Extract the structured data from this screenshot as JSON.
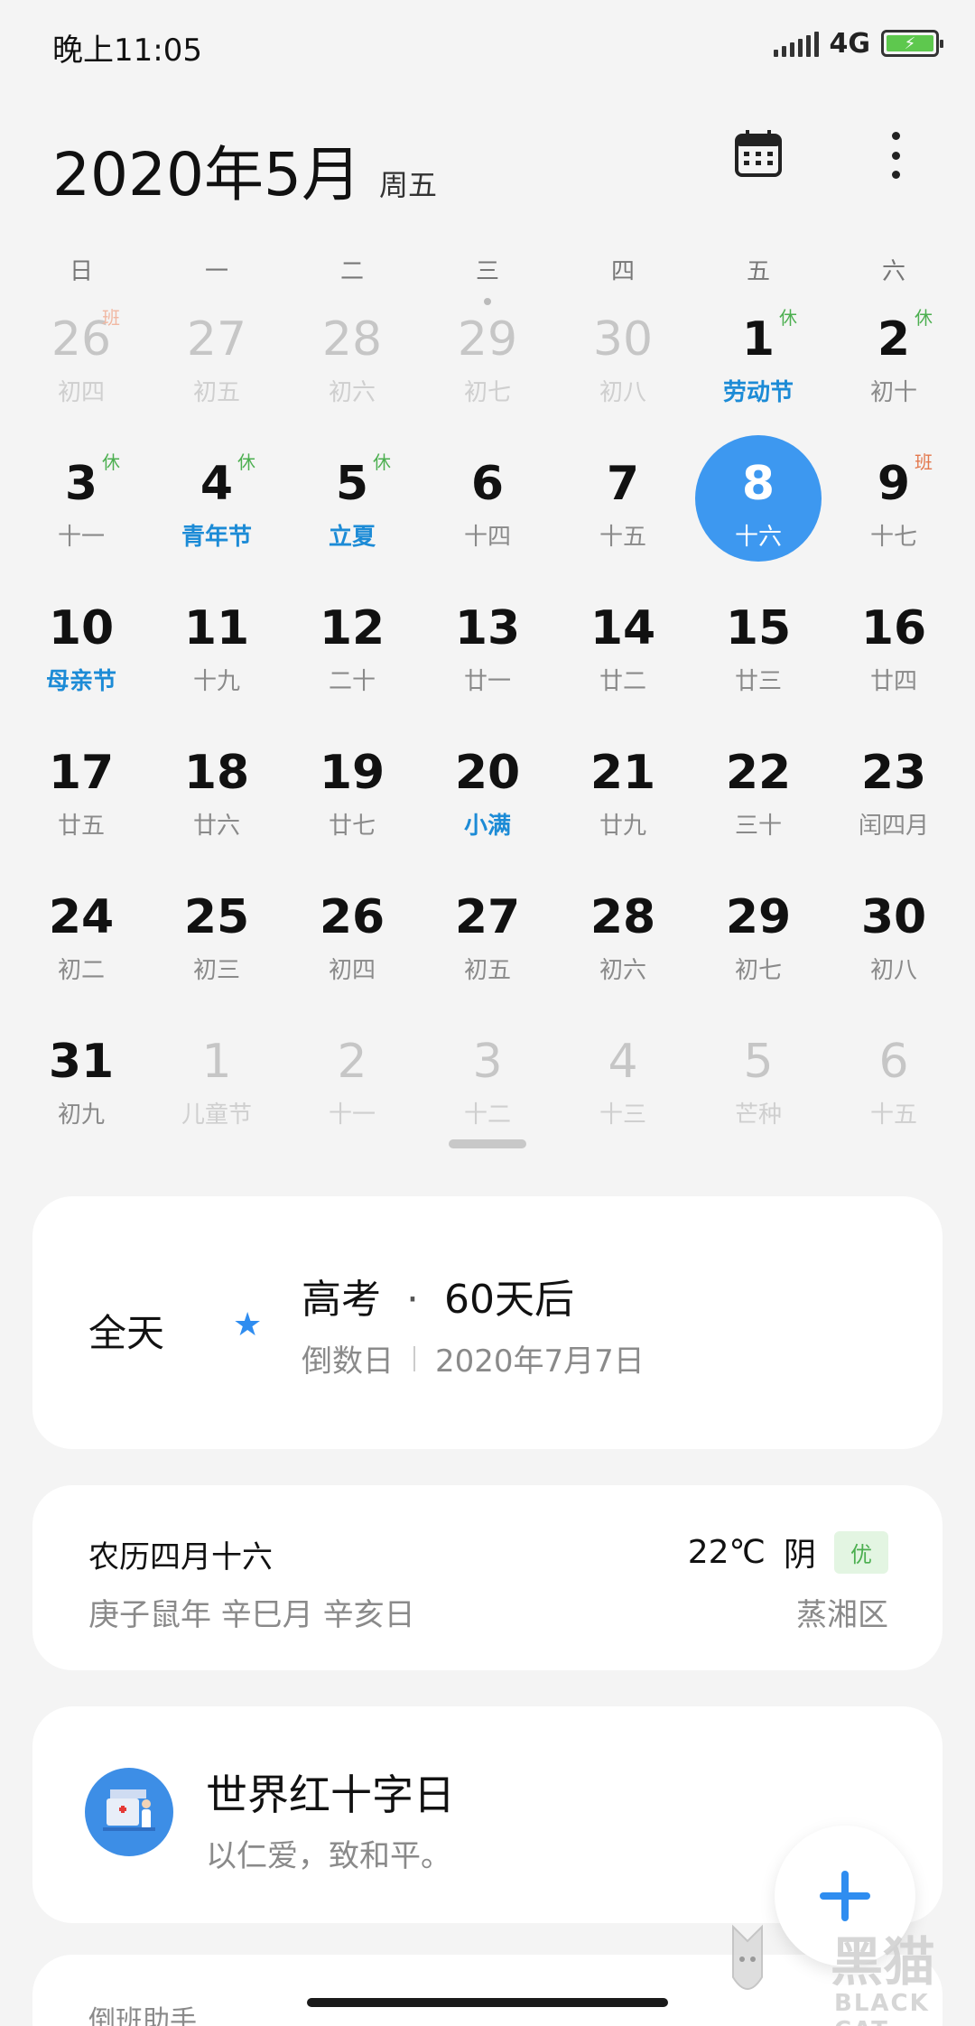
{
  "status_bar": {
    "time": "晚上11:05",
    "network": "4G",
    "battery_level_percent": 100
  },
  "header": {
    "title": "2020年5月",
    "weekday": "周五",
    "calendar_icon": "calendar-icon",
    "more_icon": "more-vertical-icon"
  },
  "weekday_headers": [
    "日",
    "一",
    "二",
    "三",
    "四",
    "五",
    "六"
  ],
  "weeks": [
    [
      {
        "day": "26",
        "lunar": "初四",
        "muted": true,
        "tag": "班",
        "tag_type": "work"
      },
      {
        "day": "27",
        "lunar": "初五",
        "muted": true
      },
      {
        "day": "28",
        "lunar": "初六",
        "muted": true
      },
      {
        "day": "29",
        "lunar": "初七",
        "muted": true,
        "dot": true
      },
      {
        "day": "30",
        "lunar": "初八",
        "muted": true
      },
      {
        "day": "1",
        "lunar": "劳动节",
        "festival": true,
        "tag": "休",
        "tag_type": "rest"
      },
      {
        "day": "2",
        "lunar": "初十",
        "tag": "休",
        "tag_type": "rest"
      }
    ],
    [
      {
        "day": "3",
        "lunar": "十一",
        "tag": "休",
        "tag_type": "rest"
      },
      {
        "day": "4",
        "lunar": "青年节",
        "festival": true,
        "tag": "休",
        "tag_type": "rest"
      },
      {
        "day": "5",
        "lunar": "立夏",
        "festival": true,
        "tag": "休",
        "tag_type": "rest"
      },
      {
        "day": "6",
        "lunar": "十四"
      },
      {
        "day": "7",
        "lunar": "十五"
      },
      {
        "day": "8",
        "lunar": "十六",
        "today": true
      },
      {
        "day": "9",
        "lunar": "十七",
        "tag": "班",
        "tag_type": "work"
      }
    ],
    [
      {
        "day": "10",
        "lunar": "母亲节",
        "festival": true
      },
      {
        "day": "11",
        "lunar": "十九"
      },
      {
        "day": "12",
        "lunar": "二十"
      },
      {
        "day": "13",
        "lunar": "廿一"
      },
      {
        "day": "14",
        "lunar": "廿二"
      },
      {
        "day": "15",
        "lunar": "廿三"
      },
      {
        "day": "16",
        "lunar": "廿四"
      }
    ],
    [
      {
        "day": "17",
        "lunar": "廿五"
      },
      {
        "day": "18",
        "lunar": "廿六"
      },
      {
        "day": "19",
        "lunar": "廿七"
      },
      {
        "day": "20",
        "lunar": "小满",
        "festival": true
      },
      {
        "day": "21",
        "lunar": "廿九"
      },
      {
        "day": "22",
        "lunar": "三十"
      },
      {
        "day": "23",
        "lunar": "闰四月"
      }
    ],
    [
      {
        "day": "24",
        "lunar": "初二"
      },
      {
        "day": "25",
        "lunar": "初三"
      },
      {
        "day": "26",
        "lunar": "初四"
      },
      {
        "day": "27",
        "lunar": "初五"
      },
      {
        "day": "28",
        "lunar": "初六"
      },
      {
        "day": "29",
        "lunar": "初七"
      },
      {
        "day": "30",
        "lunar": "初八"
      }
    ],
    [
      {
        "day": "31",
        "lunar": "初九"
      },
      {
        "day": "1",
        "lunar": "儿童节",
        "muted": true,
        "festival": true
      },
      {
        "day": "2",
        "lunar": "十一",
        "muted": true
      },
      {
        "day": "3",
        "lunar": "十二",
        "muted": true
      },
      {
        "day": "4",
        "lunar": "十三",
        "muted": true
      },
      {
        "day": "5",
        "lunar": "芒种",
        "muted": true,
        "festival": true
      },
      {
        "day": "6",
        "lunar": "十五",
        "muted": true
      }
    ]
  ],
  "event_card": {
    "all_day": "全天",
    "title": "高考",
    "separator": "·",
    "countdown": "60天后",
    "type": "倒数日",
    "date": "2020年7月7日"
  },
  "lunar_card": {
    "lunar_date": "农历四月十六",
    "ganzhi": "庚子鼠年 辛巳月 辛亥日",
    "temperature": "22℃",
    "condition": "阴",
    "aqi": "优",
    "district": "蒸湘区"
  },
  "day_card": {
    "title": "世界红十字日",
    "subtitle": "以仁爱，致和平。"
  },
  "peek_card": {
    "title": "倒班助手"
  },
  "watermark": {
    "brand_cn": "黑猫",
    "brand_en": "BLACK CAT"
  },
  "colors": {
    "accent": "#3d98f0",
    "festival": "#1c8bd6",
    "rest_tag": "#4caf50",
    "work_tag": "#e3784d"
  }
}
